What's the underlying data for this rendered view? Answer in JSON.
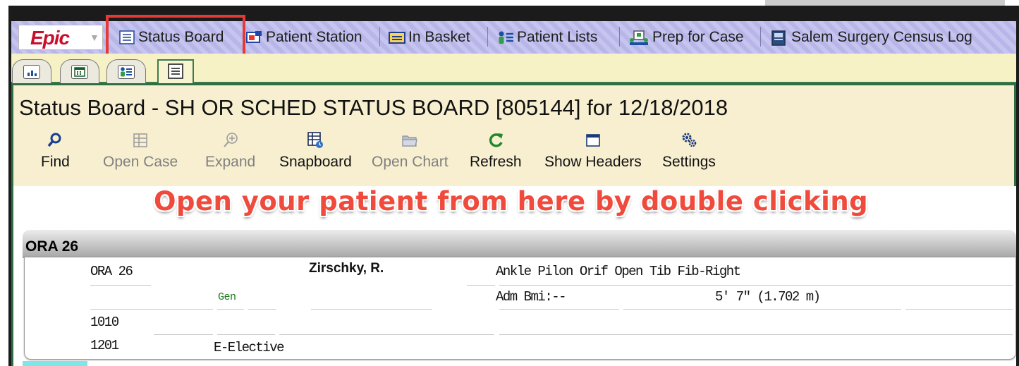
{
  "app": {
    "logo_text": "Epic",
    "brand_color": "#c8102e"
  },
  "menubar": {
    "items": [
      {
        "label": "Status Board",
        "icon": "list-icon"
      },
      {
        "label": "Patient Station",
        "icon": "patient-station-icon"
      },
      {
        "label": "In Basket",
        "icon": "inbox-icon"
      },
      {
        "label": "Patient Lists",
        "icon": "patient-list-icon"
      },
      {
        "label": "Prep for Case",
        "icon": "prep-case-icon"
      },
      {
        "label": "Salem Surgery Census Log",
        "icon": "census-log-icon"
      }
    ]
  },
  "workspace_tabs": [
    {
      "icon": "chart-icon"
    },
    {
      "icon": "calendar-icon"
    },
    {
      "icon": "patient-list-icon"
    },
    {
      "icon": "status-board-icon",
      "active": true
    }
  ],
  "page": {
    "title": "Status Board - SH OR SCHED STATUS BOARD [805144] for 12/18/2018"
  },
  "toolbar": {
    "find": "Find",
    "open_case": "Open Case",
    "expand": "Expand",
    "snapboard": "Snapboard",
    "open_chart": "Open Chart",
    "refresh": "Refresh",
    "show_headers": "Show Headers",
    "settings": "Settings"
  },
  "annotation": {
    "callout": "Open your patient from here by double clicking",
    "color": "#f04a3c"
  },
  "board": {
    "group": "ORA 26",
    "case": {
      "room": "ORA 26",
      "patient": "Zirschky, R.",
      "procedure": "Ankle Pilon Orif Open Tib Fib-Right",
      "service": "Gen",
      "bmi": "Adm Bmi:--",
      "height": "5' 7\" (1.702 m)",
      "time1": "1010",
      "time2": "1201",
      "class": "E-Elective"
    }
  }
}
